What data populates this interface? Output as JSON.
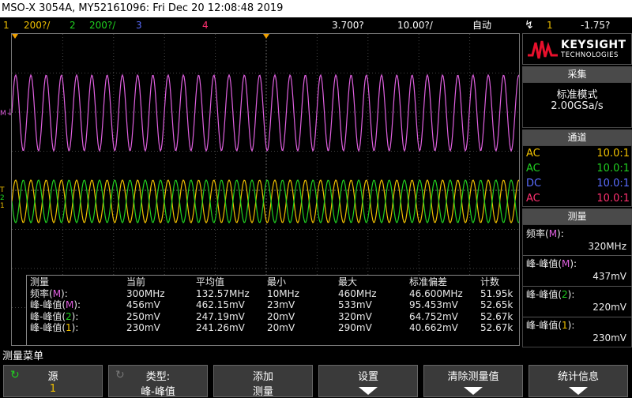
{
  "header": {
    "title": "MSO-X 3054A, MY52161096: Fri Dec 20 12:08:48 2019"
  },
  "channels": {
    "ch1": {
      "num": "1",
      "scale": "200?/",
      "color": "#f0c000"
    },
    "ch2": {
      "num": "2",
      "scale": "200?/",
      "color": "#20d020"
    },
    "ch3": {
      "num": "3",
      "color": "#5a6cff"
    },
    "ch4": {
      "num": "4",
      "color": "#ff3070"
    },
    "math_color": "#e060e0"
  },
  "timebase": {
    "delay": "3.700?",
    "scale": "10.00?/",
    "mode": "自动"
  },
  "trigger": {
    "icon": "trigger-rise-icon",
    "source": "1",
    "level": "-1.75?"
  },
  "markers": {
    "math": "M",
    "ch1": "1",
    "ch2": "2",
    "trig": "T"
  },
  "logo": {
    "brand": "KEYSIGHT",
    "sub": "TECHNOLOGIES"
  },
  "acquisition": {
    "title": "采集",
    "mode": "标准模式",
    "rate": "2.00GSa/s"
  },
  "channel_panel": {
    "title": "通道",
    "rows": [
      {
        "coupling": "AC",
        "probe": "10.0:1",
        "color": "#f0c000"
      },
      {
        "coupling": "AC",
        "probe": "10.0:1",
        "color": "#20d020"
      },
      {
        "coupling": "DC",
        "probe": "10.0:1",
        "color": "#5a6cff"
      },
      {
        "coupling": "AC",
        "probe": "10.0:1",
        "color": "#ff3070"
      }
    ]
  },
  "meas_panel": {
    "title": "测量",
    "items": [
      {
        "label_pre": "频率(",
        "src": "M",
        "label_post": "):",
        "value": "320MHz",
        "src_color": "#e060e0"
      },
      {
        "label_pre": "峰-峰值(",
        "src": "M",
        "label_post": "):",
        "value": "437mV",
        "src_color": "#e060e0"
      },
      {
        "label_pre": "峰-峰值(",
        "src": "2",
        "label_post": "):",
        "value": "220mV",
        "src_color": "#20d020"
      },
      {
        "label_pre": "峰-峰值(",
        "src": "1",
        "label_post": "):",
        "value": "230mV",
        "src_color": "#f0c000"
      }
    ]
  },
  "stats_table": {
    "headers": [
      "测量",
      "当前",
      "平均值",
      "最小",
      "最大",
      "标准偏差",
      "计数"
    ],
    "rows": [
      {
        "name_pre": "频率(",
        "src": "M",
        "name_post": "):",
        "src_color": "#e060e0",
        "cells": [
          "300MHz",
          "132.57MHz",
          "10MHz",
          "460MHz",
          "46.600MHz",
          "51.95k"
        ]
      },
      {
        "name_pre": "峰-峰值(",
        "src": "M",
        "name_post": "):",
        "src_color": "#e060e0",
        "cells": [
          "456mV",
          "462.15mV",
          "23mV",
          "533mV",
          "95.453mV",
          "52.65k"
        ]
      },
      {
        "name_pre": "峰-峰值(",
        "src": "2",
        "name_post": "):",
        "src_color": "#20d020",
        "cells": [
          "250mV",
          "247.19mV",
          "20mV",
          "320mV",
          "64.752mV",
          "52.67k"
        ]
      },
      {
        "name_pre": "峰-峰值(",
        "src": "1",
        "name_post": "):",
        "src_color": "#f0c000",
        "cells": [
          "230mV",
          "241.26mV",
          "20mV",
          "290mV",
          "40.662mV",
          "52.67k"
        ]
      }
    ]
  },
  "softkeys": {
    "menu_title": "测量菜单",
    "keys": [
      {
        "l1": "源",
        "l2": "1",
        "icon": "rotate-knob-icon"
      },
      {
        "l1": "类型:",
        "l2": "峰-峰值",
        "icon": "rotate-knob-icon"
      },
      {
        "l1": "添加",
        "l2": "测量"
      },
      {
        "l1": "设置"
      },
      {
        "l1": "清除测量值"
      },
      {
        "l1": "统计信息"
      }
    ]
  }
}
